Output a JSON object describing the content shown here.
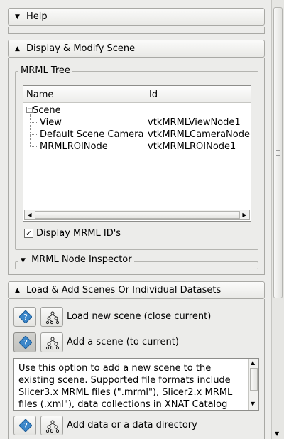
{
  "help_panel": {
    "title": "Help"
  },
  "display_panel": {
    "title": "Display & Modify Scene",
    "tree_group_title": "MRML Tree",
    "columns": [
      "Name",
      "Id"
    ],
    "root": "Scene",
    "rows": [
      {
        "name": "View",
        "id": "vtkMRMLViewNode1"
      },
      {
        "name": "Default Scene Camera",
        "id": "vtkMRMLCameraNode"
      },
      {
        "name": "MRMLROINode",
        "id": "vtkMRMLROINode1"
      }
    ],
    "display_ids_label": "Display MRML ID's",
    "display_ids_checked": true,
    "inspector_title": "MRML Node Inspector"
  },
  "load_panel": {
    "title": "Load & Add Scenes Or Individual Datasets",
    "load_new_label": "Load new scene (close current)",
    "add_scene_label": "Add a scene (to current)",
    "help_text": "Use this option to add a new scene to the existing scene. Supported file formats include Slicer3.x MRML files (\".mrml\"), Slicer2.x MRML files (.xml\"), data collections in XNAT Catalog",
    "add_data_label": "Add data or a data directory"
  },
  "colors": {
    "help_icon": "#3b86c9",
    "frame_border": "#a9a9a5"
  },
  "icons": [
    "help-diamond-icon",
    "mrml-tree-icon",
    "expand-arrow-icon",
    "collapse-arrow-icon"
  ]
}
